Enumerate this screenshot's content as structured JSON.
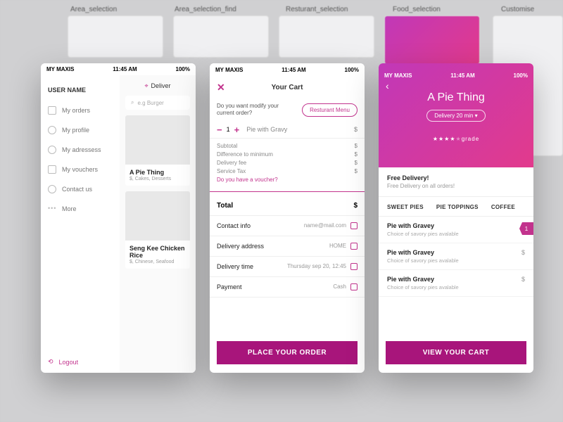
{
  "bg_labels": [
    "Area_selection",
    "Area_selection_find",
    "Resturant_selection",
    "Food_selection",
    "Customise"
  ],
  "status": {
    "carrier": "MY MAXIS",
    "time": "11:45 AM",
    "batt": "100%"
  },
  "s1": {
    "user": "USER NAME",
    "menu": [
      "My orders",
      "My profile",
      "My adressess",
      "My vouchers",
      "Contact us",
      "More"
    ],
    "logout": "Logout",
    "deliver": "Deliver",
    "search_ph": "e.g Burger",
    "cards": [
      {
        "t": "A Pie Thing",
        "s": "$, Cakes, Desserts"
      },
      {
        "t": "Seng Kee Chicken Rice",
        "s": "$, Chinese, Seafood"
      }
    ]
  },
  "s2": {
    "title": "Your Cart",
    "mod": "Do you want modify your current order?",
    "rmenu": "Resturant Menu",
    "qty": "1",
    "item": "Pie with Gravy",
    "fees": [
      "Subtotal",
      "Difference to minimum",
      "Delivery fee",
      "Service Tax"
    ],
    "voucher": "Do you have a voucher?",
    "total": "Total",
    "cur": "$",
    "info": [
      {
        "k": "Contact info",
        "v": "name@mail.com"
      },
      {
        "k": "Delivery address",
        "v": "HOME"
      },
      {
        "k": "Delivery time",
        "v": "Thursday sep 20, 12:45"
      },
      {
        "k": "Payment",
        "v": "Cash"
      }
    ],
    "cta": "PLACE YOUR ORDER"
  },
  "s3": {
    "name": "A Pie Thing",
    "delivery": "Delivery 20 min",
    "stars": "★★★★",
    "grade": "grade",
    "fd_t": "Free Delivery!",
    "fd_d": "Free Delivery on all orders!",
    "tabs": [
      "SWEET PIES",
      "PIE TOPPINGS",
      "COFFEE"
    ],
    "badge": "1",
    "items": [
      {
        "n": "Pie with Gravey",
        "d": "Choice of savory pies avalable",
        "p": "$"
      },
      {
        "n": "Pie with Gravey",
        "d": "Choice of savory pies avalable",
        "p": "$"
      },
      {
        "n": "Pie with Gravey",
        "d": "Choice of savory pies avalable",
        "p": "$"
      }
    ],
    "cta": "VIEW YOUR CART"
  }
}
